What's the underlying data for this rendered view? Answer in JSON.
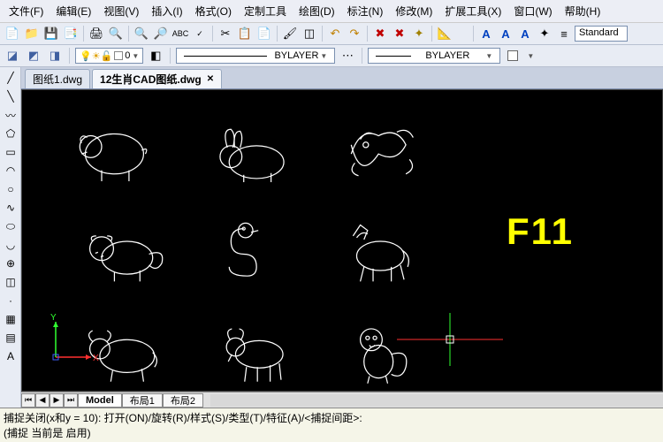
{
  "menu": {
    "file": "文件(F)",
    "edit": "编辑(E)",
    "view": "视图(V)",
    "insert": "插入(I)",
    "format": "格式(O)",
    "custom_tools": "定制工具",
    "draw": "绘图(D)",
    "annotation": "标注(N)",
    "modify": "修改(M)",
    "extension_tools": "扩展工具(X)",
    "window": "窗口(W)",
    "help": "帮助(H)"
  },
  "style_combo": "Standard",
  "layer": {
    "name": "0"
  },
  "linetype": "BYLAYER",
  "lineweight": "BYLAYER",
  "tabs": {
    "items": [
      {
        "label": "图纸1.dwg",
        "active": false
      },
      {
        "label": "12生肖CAD图纸.dwg",
        "active": true
      }
    ]
  },
  "overlay": {
    "text": "F11"
  },
  "layout_tabs": {
    "model": "Model",
    "layout1": "布局1",
    "layout2": "布局2"
  },
  "command": {
    "line1": "捕捉关闭(x和y = 10):   打开(ON)/旋转(R)/样式(S)/类型(T)/特征(A)/<捕捉间距>:",
    "line2": "(捕捉 当前是  启用)"
  },
  "ucs_labels": {
    "x": "X",
    "y": "Y"
  }
}
